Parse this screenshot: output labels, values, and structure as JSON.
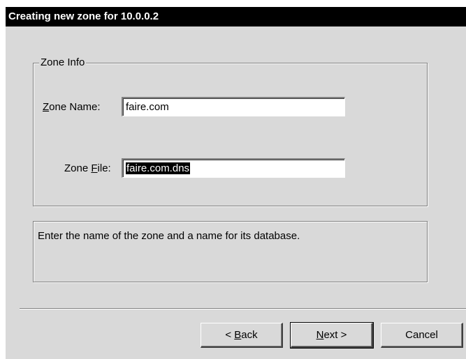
{
  "window": {
    "title": "Creating new zone for 10.0.0.2"
  },
  "zone_info": {
    "group_label": "Zone Info",
    "zone_name_label_prefix": "",
    "zone_name_label_mnemonic": "Z",
    "zone_name_label_rest": "one Name:",
    "zone_name_value": "faire.com",
    "zone_file_label_prefix": "Zone ",
    "zone_file_label_mnemonic": "F",
    "zone_file_label_rest": "ile:",
    "zone_file_value": "faire.com.dns"
  },
  "description": "Enter the name of the zone and a name for its database.",
  "buttons": {
    "back_prefix": "< ",
    "back_mnemonic": "B",
    "back_rest": "ack",
    "next_mnemonic": "N",
    "next_rest": "ext >",
    "cancel": "Cancel"
  }
}
